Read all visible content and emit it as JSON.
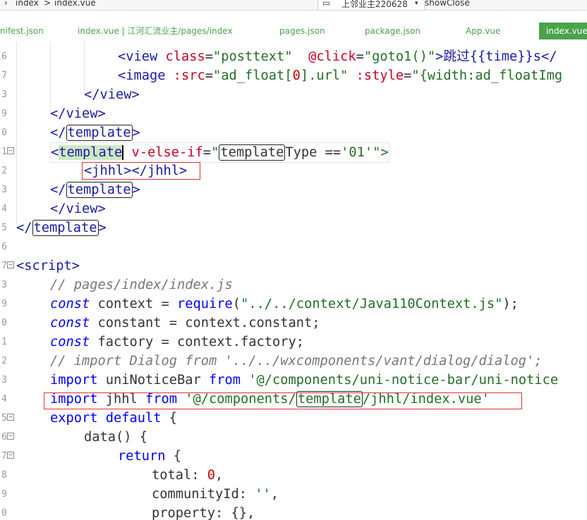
{
  "titlebar": {
    "crumb_first": "index",
    "crumb_sep": ">",
    "crumb_second": "index.vue",
    "project_name": "上邻业主220628",
    "method_name": "showClose"
  },
  "tabs": [
    {
      "label": "nifest.json"
    },
    {
      "label": "index.vue | 江河汇流业主/pages/index"
    },
    {
      "label": "pages.json"
    },
    {
      "label": "package.json"
    },
    {
      "label": "App.vue"
    },
    {
      "label": "index.vue"
    }
  ],
  "gutter": [
    "6",
    "7",
    "3",
    "9",
    "0",
    "1",
    "2",
    "3",
    "4",
    "5",
    "6",
    "7",
    "3",
    "9",
    "0",
    "1",
    "2",
    "3",
    "4",
    "5",
    "6",
    "7",
    "8",
    "9",
    "0",
    "1"
  ],
  "code": {
    "l1": {
      "p1": "<view ",
      "p2": "class",
      "p3": "=",
      "p4": "\"posttext\"",
      "p5": "  @",
      "p6": "click",
      "p7": "=",
      "p8": "\"goto1()\"",
      "p9": ">跳过{{time}}s</"
    },
    "l2": {
      "p1": "<image ",
      "p2": ":src",
      "p3": "=",
      "p4": "\"ad_float[",
      "p5": "0",
      "p6": "].url\" ",
      "p7": ":style",
      "p8": "=",
      "p9": "\"{width:ad_floatImg"
    },
    "l3": {
      "p1": "</view>"
    },
    "l4": {
      "p1": "</view>"
    },
    "l5": {
      "p1": "</",
      "p2": "template",
      "p3": ">"
    },
    "l6": {
      "p1": "<",
      "p2": "template",
      "p3": " v-else-if",
      "p4": "=",
      "p5": "\"",
      "p6": "template",
      "p7": "Type ==",
      "p8": "'01'",
      "p9": "\">"
    },
    "l7": {
      "p1": "<jhhl></jhhl>"
    },
    "l8": {
      "p1": "</",
      "p2": "template",
      "p3": ">"
    },
    "l9": {
      "p1": "</view>"
    },
    "l10": {
      "p1": "</",
      "p2": "template",
      "p3": ">"
    },
    "l12": {
      "p1": "<script>"
    },
    "l13": {
      "p1": "// pages/index/index.js"
    },
    "l14": {
      "p1": "const",
      "p2": " context = ",
      "p3": "require",
      "p4": "(",
      "p5": "\"../../context/Java110Context.js\"",
      "p6": ");"
    },
    "l15": {
      "p1": "const",
      "p2": " constant = context.constant;"
    },
    "l16": {
      "p1": "const",
      "p2": " factory = context.factory;"
    },
    "l17": {
      "p1": "// import Dialog from '../../wxcomponents/vant/dialog/dialog';"
    },
    "l18": {
      "p1": "import",
      "p2": " uniNoticeBar ",
      "p3": "from",
      "p4": " '@/components/uni-notice-bar/uni-notice"
    },
    "l19": {
      "p1": "import",
      "p2": " jhhl ",
      "p3": "from",
      "p4": " '@/components/",
      "p5": "template",
      "p6": "/jhhl/index.vue'"
    },
    "l20": {
      "p1": "export default",
      "p2": " {"
    },
    "l21": {
      "p1": "data() {"
    },
    "l22": {
      "p1": "return",
      "p2": " {"
    },
    "l23": {
      "p1": "total: ",
      "p2": "0",
      "p3": ","
    },
    "l24": {
      "p1": "communityId: ",
      "p2": "''",
      "p3": ","
    },
    "l25": {
      "p1": "property: {},"
    }
  },
  "colors": {
    "tab_active": "#4aa34a",
    "tag": "#1a1aa6",
    "attr": "#c8002a",
    "string": "#236e25",
    "keyword": "#0000ff",
    "comment": "#777777",
    "highlight_box": "#e03030"
  }
}
